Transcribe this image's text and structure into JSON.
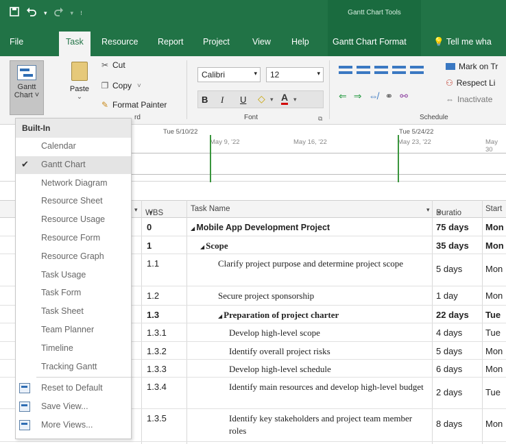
{
  "qat": {
    "save_icon": "save-icon",
    "undo_icon": "undo-icon",
    "redo_icon": "redo-icon",
    "customize_icon": "qat-dropdown-icon"
  },
  "context": {
    "group_label": "Gantt Chart Tools"
  },
  "tabs": [
    {
      "label": "File"
    },
    {
      "label": "Task"
    },
    {
      "label": "Resource"
    },
    {
      "label": "Report"
    },
    {
      "label": "Project"
    },
    {
      "label": "View"
    },
    {
      "label": "Help"
    },
    {
      "label": "Gantt Chart Format"
    }
  ],
  "tell_me": "Tell me wha",
  "ribbon": {
    "gantt_line1": "Gantt",
    "gantt_line2": "Chart ˅",
    "paste": "Paste",
    "paste_arrow": "⌄",
    "cut": "Cut",
    "copy": "Copy",
    "copy_arrow": "˅",
    "format_painter": "Format Painter",
    "clipboard_label_partial": "rd",
    "font_name": "Calibri",
    "font_size": "12",
    "bold": "B",
    "italic": "I",
    "underline": "U",
    "font_label": "Font",
    "schedule_label": "Schedule",
    "mark_on_track": "Mark on Tr",
    "respect_links": "Respect Li",
    "inactivate": "Inactivate"
  },
  "timeline": {
    "date_left": "Tue 5/10/22",
    "date_right": "Tue 5/24/22",
    "ticks": [
      "May 9, '22",
      "May 16, '22",
      "May 23, '22",
      "May 30"
    ]
  },
  "table": {
    "headers": {
      "wbs": "WBS",
      "task_name": "Task Name",
      "duration": "Duratio",
      "start": "Start"
    },
    "rows": [
      {
        "wbs": "0",
        "name": "Mobile App Development Project",
        "dur": "75 days",
        "start": "Mon",
        "bold": true,
        "level": 0,
        "sans": true
      },
      {
        "wbs": "1",
        "name": "Scope",
        "dur": "35 days",
        "start": "Mon",
        "bold": true,
        "level": 1
      },
      {
        "wbs": "1.1",
        "name": "Clarify project purpose and determine project scope",
        "dur": "5 days",
        "start": "Mon",
        "bold": false,
        "level": 2
      },
      {
        "wbs": "1.2",
        "name": "Secure project sponsorship",
        "dur": "1 day",
        "start": "Mon",
        "bold": false,
        "level": 2
      },
      {
        "wbs": "1.3",
        "name": "Preparation of project charter",
        "dur": "22 days",
        "start": "Tue",
        "bold": true,
        "level": 2
      },
      {
        "wbs": "1.3.1",
        "name": "Develop high-level scope",
        "dur": "4 days",
        "start": "Tue",
        "bold": false,
        "level": 3
      },
      {
        "wbs": "1.3.2",
        "name": "Identify overall project risks",
        "dur": "5 days",
        "start": "Mon",
        "bold": false,
        "level": 3
      },
      {
        "wbs": "1.3.3",
        "name": "Develop high-level schedule",
        "dur": "6 days",
        "start": "Mon",
        "bold": false,
        "level": 3
      },
      {
        "wbs": "1.3.4",
        "name": "Identify main resources and develop high-level budget",
        "dur": "2 days",
        "start": "Tue",
        "bold": false,
        "level": 3
      },
      {
        "wbs": "1.3.5",
        "name": "Identify key stakeholders and project team member roles",
        "dur": "8 days",
        "start": "Mon",
        "bold": false,
        "level": 3
      }
    ]
  },
  "dropdown": {
    "header": "Built-In",
    "items": [
      {
        "label": "Calendar",
        "checked": false
      },
      {
        "label": "Gantt Chart",
        "checked": true
      },
      {
        "label": "Network Diagram",
        "checked": false
      },
      {
        "label": "Resource Sheet",
        "checked": false
      },
      {
        "label": "Resource Usage",
        "checked": false
      },
      {
        "label": "Resource Form",
        "checked": false
      },
      {
        "label": "Resource Graph",
        "checked": false
      },
      {
        "label": "Task Usage",
        "checked": false
      },
      {
        "label": "Task Form",
        "checked": false
      },
      {
        "label": "Task Sheet",
        "checked": false
      },
      {
        "label": "Team Planner",
        "checked": false
      },
      {
        "label": "Timeline",
        "checked": false
      },
      {
        "label": "Tracking Gantt",
        "checked": false
      }
    ],
    "actions": [
      {
        "label": "Reset to Default",
        "icon": "reset-view-icon"
      },
      {
        "label": "Save View...",
        "icon": "save-view-icon"
      },
      {
        "label": "More Views...",
        "icon": "more-views-icon"
      }
    ]
  },
  "colors": {
    "accent": "#217346",
    "context_tab": "#1a6b3f",
    "timeline_marker": "#39953c"
  }
}
